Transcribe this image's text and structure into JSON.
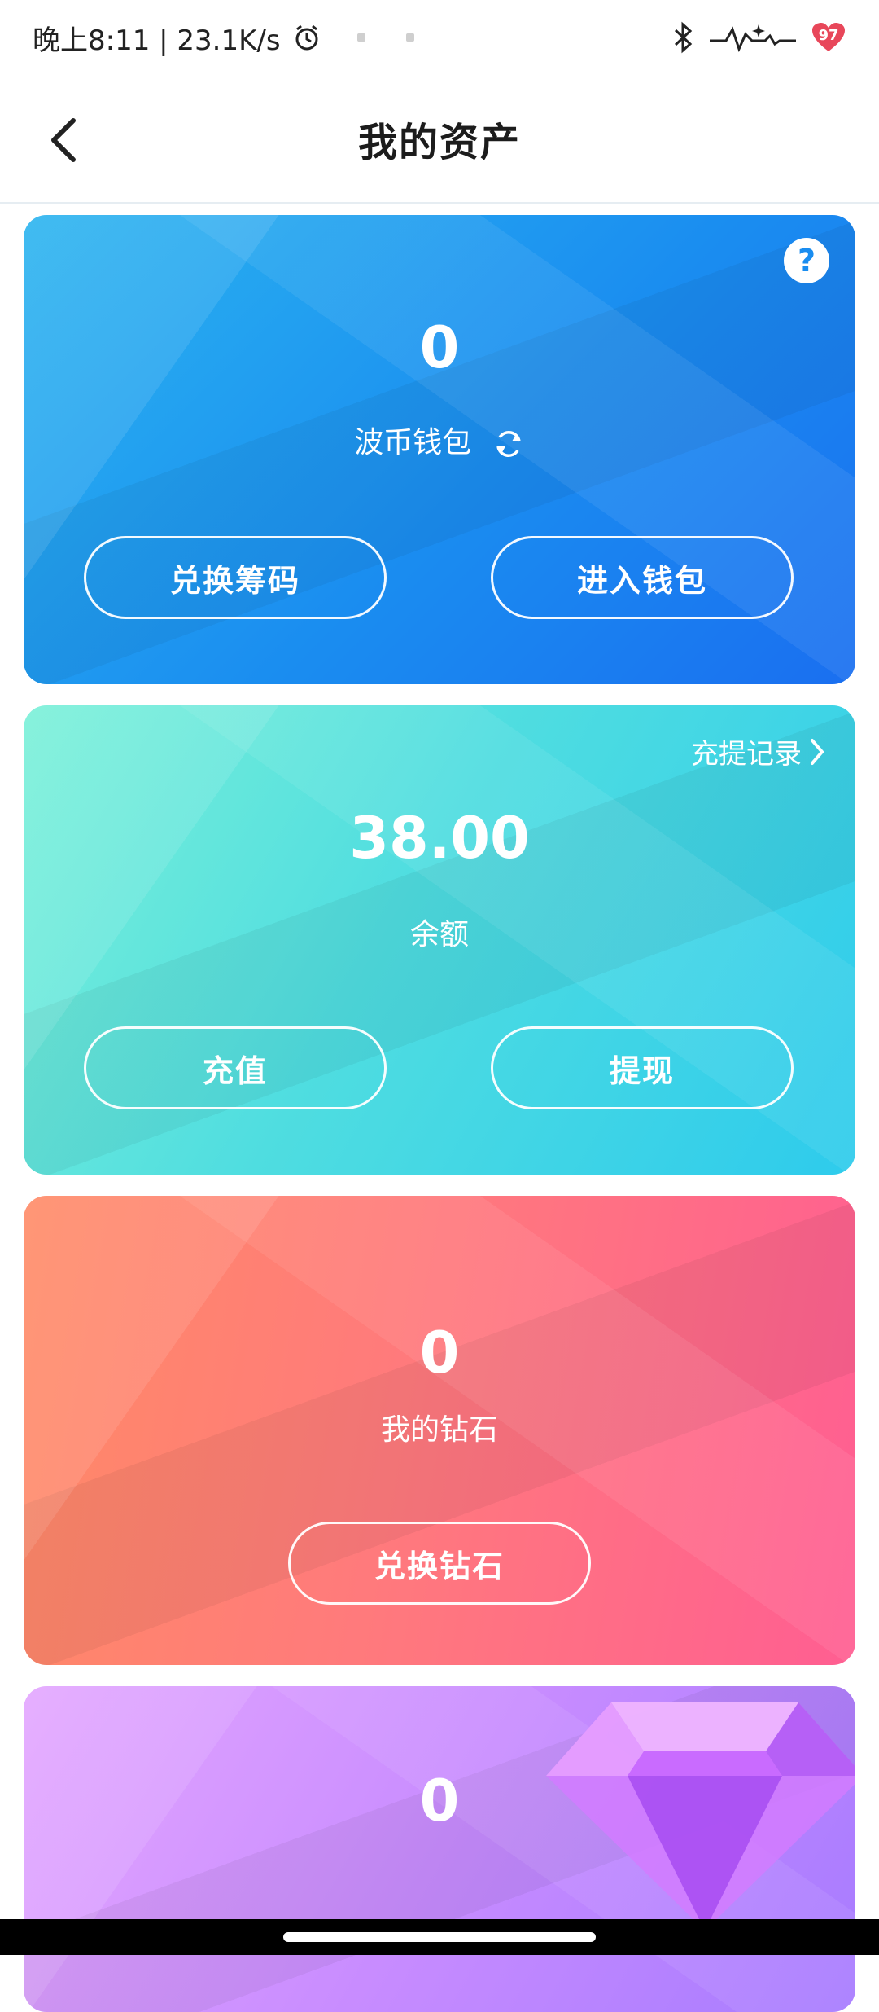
{
  "status_bar": {
    "time_speed": "晚上8:11 | 23.1K/s",
    "battery": "97"
  },
  "nav": {
    "title": "我的资产"
  },
  "cards": {
    "bobi": {
      "amount": "0",
      "label": "波币钱包",
      "btn_exchange": "兑换筹码",
      "btn_enter": "进入钱包"
    },
    "balance": {
      "link": "充提记录",
      "amount": "38.00",
      "label": "余额",
      "btn_recharge": "充值",
      "btn_withdraw": "提现"
    },
    "diamond": {
      "amount": "0",
      "label": "我的钻石",
      "btn_exchange": "兑换钻石"
    },
    "fourth": {
      "amount": "0"
    }
  },
  "colors": {
    "blue": "#1a8df0",
    "teal": "#4fdde0",
    "pink": "#ff6f88",
    "purple": "#c88cff"
  }
}
